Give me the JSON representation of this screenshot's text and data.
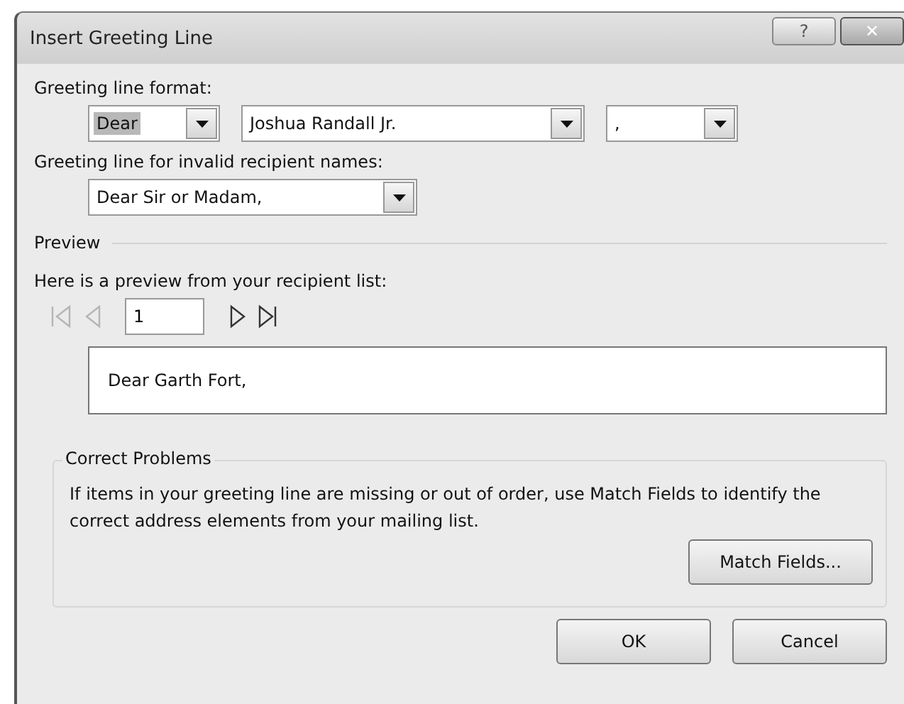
{
  "window": {
    "title": "Insert Greeting Line",
    "buttons": [
      {
        "kind": "help",
        "label": "?"
      },
      {
        "kind": "close",
        "label": "✕"
      }
    ]
  },
  "greeting_format": {
    "label": "Greeting line format:",
    "combos": [
      {
        "value": "Dear",
        "highlighted": true
      },
      {
        "value": "Joshua Randall Jr.",
        "highlighted": false
      },
      {
        "value": ",",
        "highlighted": false
      }
    ]
  },
  "invalid_names": {
    "label": "Greeting line for invalid recipient names:",
    "combo": {
      "value": "Dear Sir or Madam,"
    }
  },
  "preview": {
    "heading": "Preview",
    "intro": "Here is a preview from your recipient list:",
    "record": "1",
    "nav": [
      {
        "kind": "first",
        "disabled": true
      },
      {
        "kind": "previous",
        "disabled": true
      },
      {
        "kind": "next",
        "disabled": false
      },
      {
        "kind": "last",
        "disabled": false
      }
    ],
    "text": "Dear Garth Fort,"
  },
  "correct_problems": {
    "heading": "Correct Problems",
    "text": "If items in your greeting line are missing or out of order, use Match Fields to identify the correct address elements from your mailing list.",
    "button": "Match Fields..."
  },
  "buttons": [
    "OK",
    "Cancel"
  ]
}
